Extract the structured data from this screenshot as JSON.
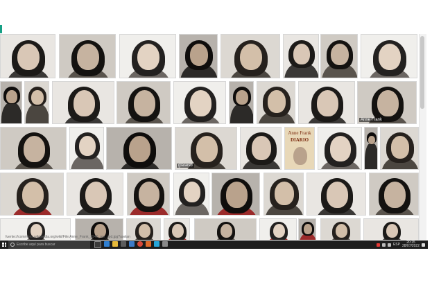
{
  "status_url": "fuente://commons.wikimedia.org/wiki/File:Anne_Frank_1940_rev_upd.jpg?uselang=es",
  "book_cover": {
    "line1": "Anne Frank",
    "line2": "DIARIO"
  },
  "watermark": "glasesb",
  "tile_caption": "Anne Frank",
  "taskbar": {
    "search_placeholder": "Escribe aquí para buscar",
    "time": "20:15",
    "date": "28/07/2022",
    "lang": "ESP"
  },
  "colors": {
    "taskbar": "#1d1d1d",
    "accent": "#16a085"
  },
  "icons": [
    "windows-start-icon",
    "search-icon",
    "task-view-icon",
    "edge-icon",
    "file-explorer-icon",
    "store-icon",
    "mail-icon",
    "chrome-icon",
    "office-icon",
    "photos-icon",
    "media-icon",
    "network-icon",
    "volume-icon",
    "notifications-icon"
  ]
}
